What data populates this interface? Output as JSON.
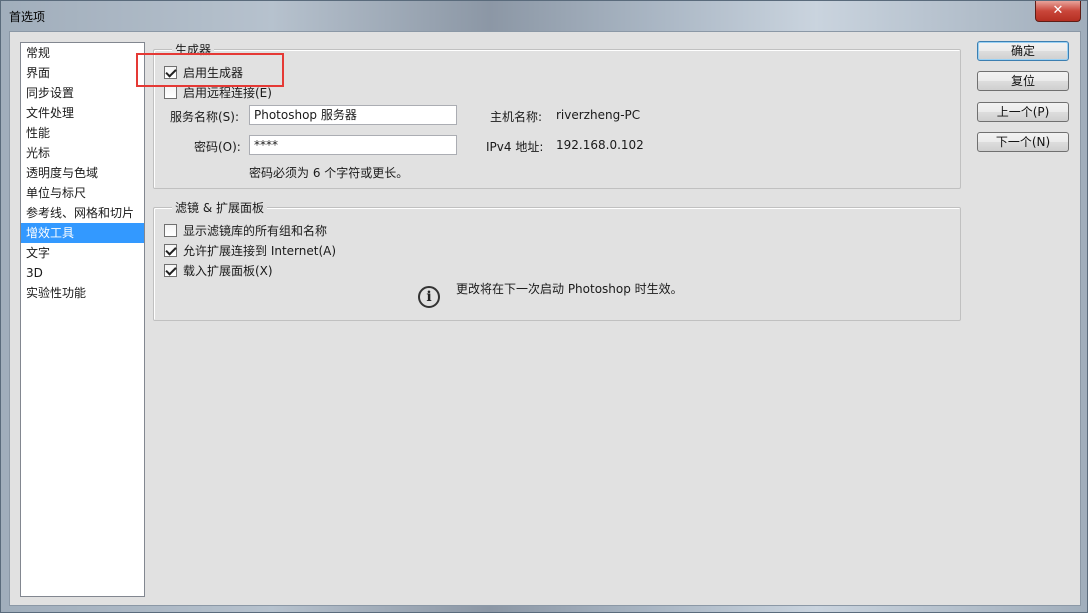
{
  "window": {
    "title": "首选项",
    "close_glyph": "✕"
  },
  "nav": {
    "items": [
      {
        "label": "常规"
      },
      {
        "label": "界面"
      },
      {
        "label": "同步设置"
      },
      {
        "label": "文件处理"
      },
      {
        "label": "性能"
      },
      {
        "label": "光标"
      },
      {
        "label": "透明度与色域"
      },
      {
        "label": "单位与标尺"
      },
      {
        "label": "参考线、网格和切片"
      },
      {
        "label": "增效工具",
        "selected": true
      },
      {
        "label": "文字"
      },
      {
        "label": "3D"
      },
      {
        "label": "实验性功能"
      }
    ]
  },
  "generator": {
    "title": "生成器",
    "enable_generator": {
      "label": "启用生成器",
      "checked": true
    },
    "enable_remote": {
      "label": "启用远程连接(E)",
      "checked": false
    },
    "service_name_label": "服务名称(S):",
    "service_name_value": "Photoshop 服务器",
    "password_label": "密码(O):",
    "password_value": "****",
    "hostname_label": "主机名称:",
    "hostname_value": "riverzheng-PC",
    "ipv4_label": "IPv4 地址:",
    "ipv4_value": "192.168.0.102",
    "password_hint": "密码必须为 6 个字符或更长。"
  },
  "filters": {
    "title": "滤镜 & 扩展面板",
    "show_all_groups": {
      "label": "显示滤镜库的所有组和名称",
      "checked": false
    },
    "allow_internet": {
      "label": "允许扩展连接到 Internet(A)",
      "checked": true
    },
    "load_panels": {
      "label": "载入扩展面板(X)",
      "checked": true
    },
    "notice": "更改将在下一次启动 Photoshop 时生效。",
    "info_icon": "info-icon"
  },
  "buttons": {
    "ok": "确定",
    "reset": "复位",
    "prev": "上一个(P)",
    "next": "下一个(N)"
  },
  "colors": {
    "selection": "#3399ff",
    "highlight_box": "#e53935",
    "dialog_bg": "#e1e1e1"
  }
}
